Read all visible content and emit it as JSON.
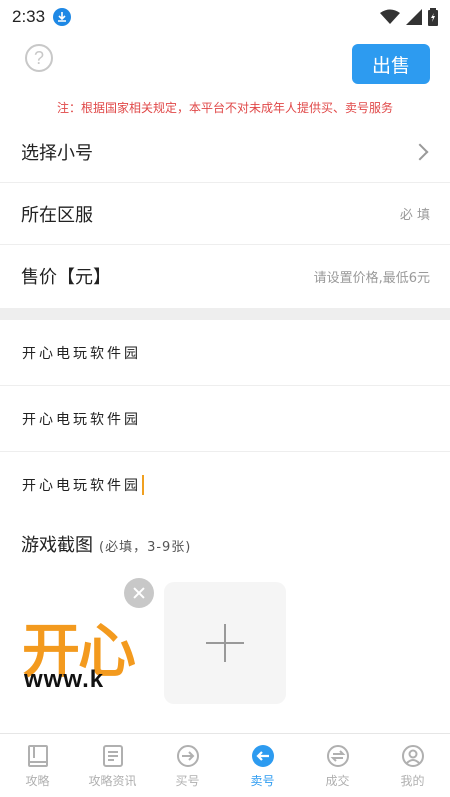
{
  "status": {
    "time": "2:33"
  },
  "header": {
    "sell_label": "出售",
    "help_glyph": "?"
  },
  "notice": "注：根据国家相关规定，本平台不对未成年人提供买、卖号服务",
  "form": {
    "choose_account": {
      "label": "选择小号"
    },
    "server": {
      "label": "所在区服",
      "placeholder": "必 填"
    },
    "price": {
      "label": "售价【元】",
      "placeholder": "请设置价格,最低6元"
    }
  },
  "fields": {
    "title": "开心电玩软件园",
    "description": "开心电玩软件园",
    "note": "开心电玩软件园"
  },
  "screenshots": {
    "title": "游戏截图",
    "hint": "(必填，3-9张)",
    "thumb_logo": "开心",
    "thumb_url": "www.k"
  },
  "tabs": [
    {
      "label": "攻略",
      "icon": "book-icon"
    },
    {
      "label": "攻略资讯",
      "icon": "news-icon"
    },
    {
      "label": "买号",
      "icon": "arrow-right-circle-icon"
    },
    {
      "label": "卖号",
      "icon": "arrow-left-circle-icon"
    },
    {
      "label": "成交",
      "icon": "exchange-circle-icon"
    },
    {
      "label": "我的",
      "icon": "user-circle-icon"
    }
  ],
  "colors": {
    "accent": "#2d9bf0",
    "notice": "#e04848"
  }
}
